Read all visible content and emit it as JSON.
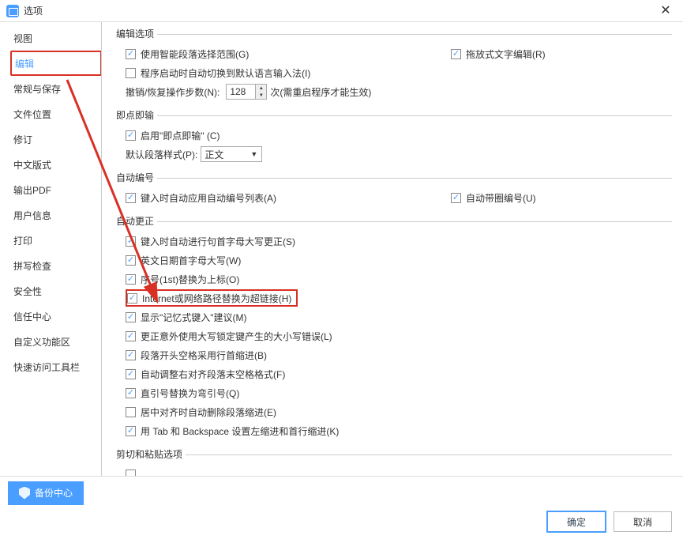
{
  "title": "选项",
  "sidebar": {
    "items": [
      {
        "label": "视图"
      },
      {
        "label": "编辑"
      },
      {
        "label": "常规与保存"
      },
      {
        "label": "文件位置"
      },
      {
        "label": "修订"
      },
      {
        "label": "中文版式"
      },
      {
        "label": "输出PDF"
      },
      {
        "label": "用户信息"
      },
      {
        "label": "打印"
      },
      {
        "label": "拼写检查"
      },
      {
        "label": "安全性"
      },
      {
        "label": "信任中心"
      },
      {
        "label": "自定义功能区"
      },
      {
        "label": "快速访问工具栏"
      }
    ],
    "selected_index": 1
  },
  "groups": {
    "edit_options": {
      "title": "编辑选项",
      "smart_paragraph": {
        "checked": true,
        "label": "使用智能段落选择范围(G)"
      },
      "drag_text": {
        "checked": true,
        "label": "拖放式文字编辑(R)"
      },
      "auto_ime": {
        "checked": false,
        "label": "程序启动时自动切换到默认语言输入法(I)"
      },
      "undo_label": "撤销/恢复操作步数(N):",
      "undo_value": "128",
      "undo_suffix": "次(需重启程序才能生效)"
    },
    "click_type": {
      "title": "即点即输",
      "enable": {
        "checked": true,
        "label": "启用\"即点即输\" (C)"
      },
      "default_style_label": "默认段落样式(P):",
      "default_style_value": "正文"
    },
    "auto_number": {
      "title": "自动编号",
      "apply_list": {
        "checked": true,
        "label": "键入时自动应用自动编号列表(A)"
      },
      "auto_circle": {
        "checked": true,
        "label": "自动带圈编号(U)"
      }
    },
    "auto_correct": {
      "title": "自动更正",
      "items": [
        {
          "checked": true,
          "label": "键入时自动进行句首字母大写更正(S)"
        },
        {
          "checked": true,
          "label": "英文日期首字母大写(W)"
        },
        {
          "checked": true,
          "label": "序号(1st)替换为上标(O)"
        },
        {
          "checked": true,
          "label": "Internet或网络路径替换为超链接(H)",
          "highlight": true
        },
        {
          "checked": true,
          "label": "显示\"记忆式键入\"建议(M)"
        },
        {
          "checked": true,
          "label": "更正意外使用大写锁定键产生的大小写错误(L)"
        },
        {
          "checked": true,
          "label": "段落开头空格采用行首缩进(B)"
        },
        {
          "checked": true,
          "label": "自动调整右对齐段落末空格格式(F)"
        },
        {
          "checked": true,
          "label": "直引号替换为弯引号(Q)"
        },
        {
          "checked": false,
          "label": "居中对齐时自动删除段落缩进(E)"
        },
        {
          "checked": true,
          "label": "用 Tab 和 Backspace 设置左缩进和首行缩进(K)"
        }
      ]
    },
    "cut_paste": {
      "title": "剪切和粘贴选项"
    }
  },
  "backup_button": "备份中心",
  "buttons": {
    "ok": "确定",
    "cancel": "取消"
  }
}
